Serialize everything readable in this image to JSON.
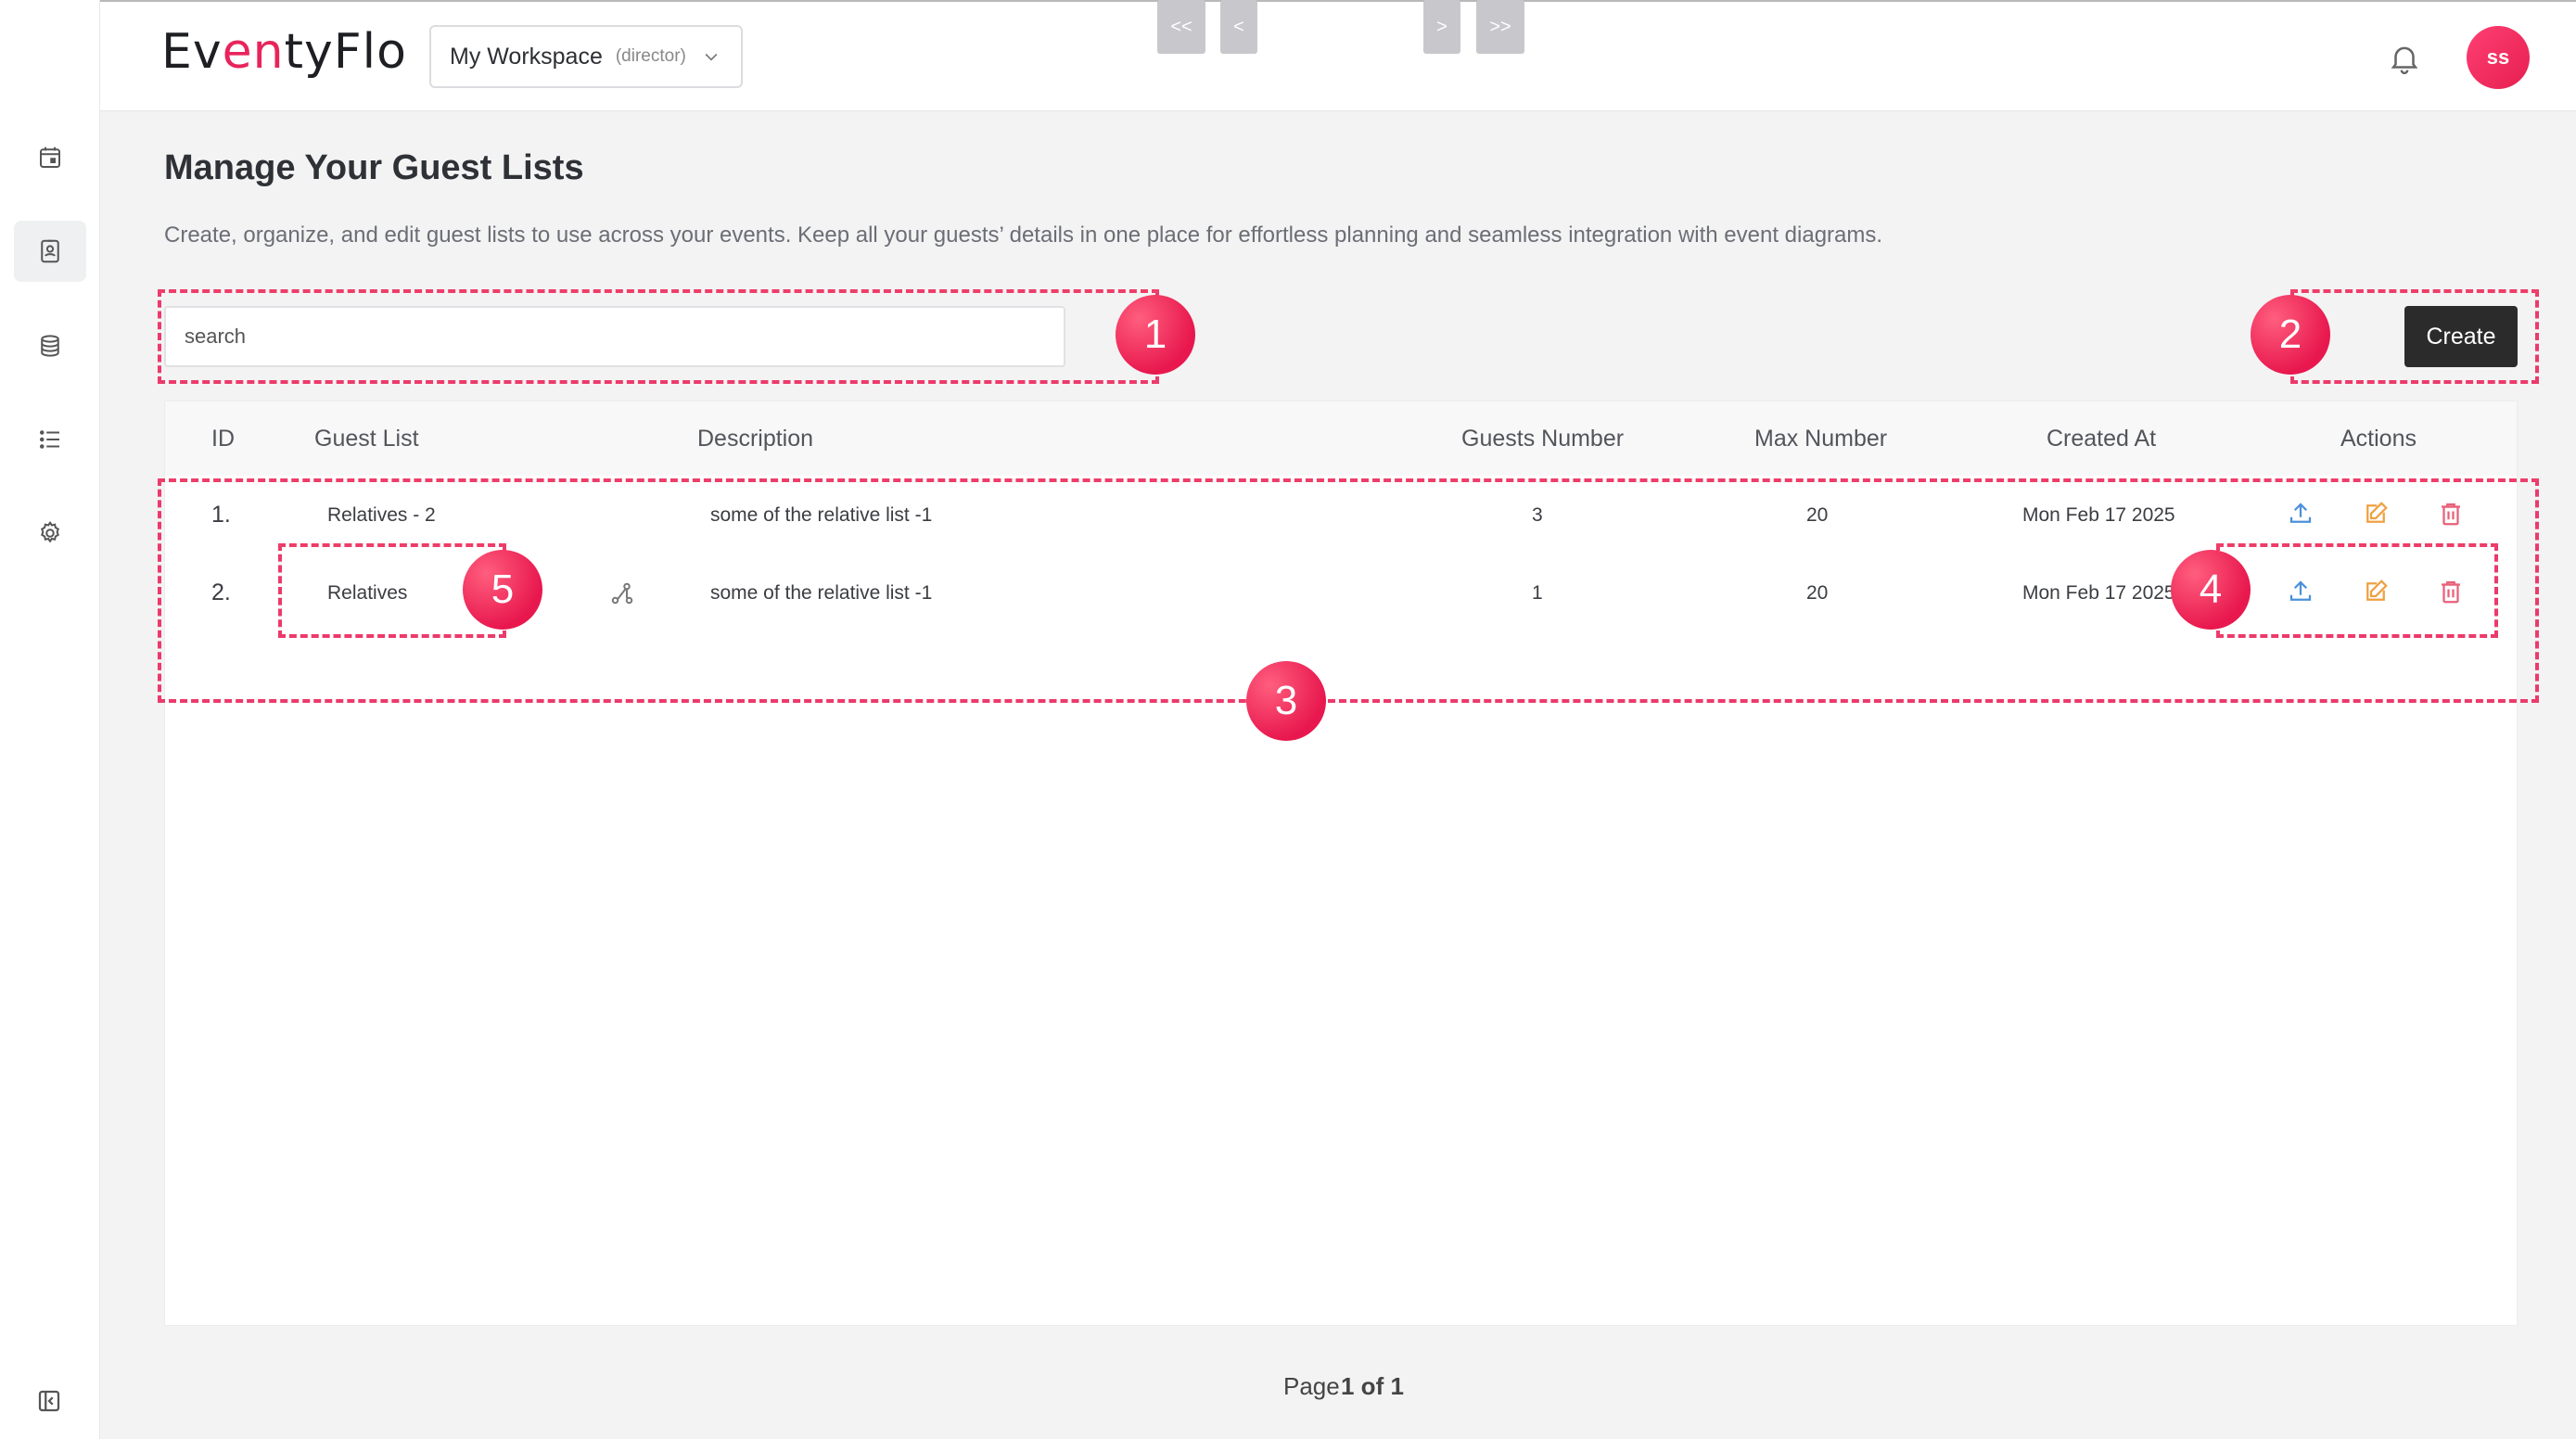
{
  "app": {
    "logo": "EventyFlo",
    "logo_parts": [
      "Ev",
      "en",
      "tyFlo"
    ]
  },
  "header": {
    "workspace_name": "My Workspace",
    "workspace_role": "(director)",
    "avatar_initials": "ss"
  },
  "page": {
    "title": "Manage Your Guest Lists",
    "description": "Create, organize, and edit guest lists to use across your events. Keep all your guests’ details in one place for effortless planning and seamless integration with event diagrams."
  },
  "search": {
    "placeholder": "search"
  },
  "create_label": "Create",
  "table": {
    "headers": [
      "ID",
      "Guest List",
      "Description",
      "Guests Number",
      "Max Number",
      "Created At",
      "Actions"
    ],
    "rows": [
      {
        "id": "1.",
        "name": "Relatives - 2",
        "description": "some of the relative list -1",
        "guests": "3",
        "max": "20",
        "created": "Mon Feb 17 2025"
      },
      {
        "id": "2.",
        "name": "Relatives",
        "description": "some of the relative list -1",
        "guests": "1",
        "max": "20",
        "created": "Mon Feb 17 2025"
      }
    ]
  },
  "pagination": {
    "first": "<<",
    "prev": "<",
    "next": ">",
    "last": ">>",
    "label": "Page",
    "current": "1 of 1"
  },
  "annotations": [
    "1",
    "2",
    "3",
    "4",
    "5"
  ],
  "colors": {
    "accent": "#e8245b",
    "annotation_orange": "#ef5b3f",
    "upload_icon": "#4a90d9",
    "edit_icon": "#f0a040",
    "delete_icon": "#e8607a"
  },
  "icons": {
    "sidebar": [
      "calendar-icon",
      "guest-list-icon",
      "database-icon",
      "list-icon",
      "settings-icon"
    ],
    "row_actions": [
      "upload-icon",
      "edit-icon",
      "delete-icon"
    ],
    "diagram_link": "diagram-link-icon"
  }
}
